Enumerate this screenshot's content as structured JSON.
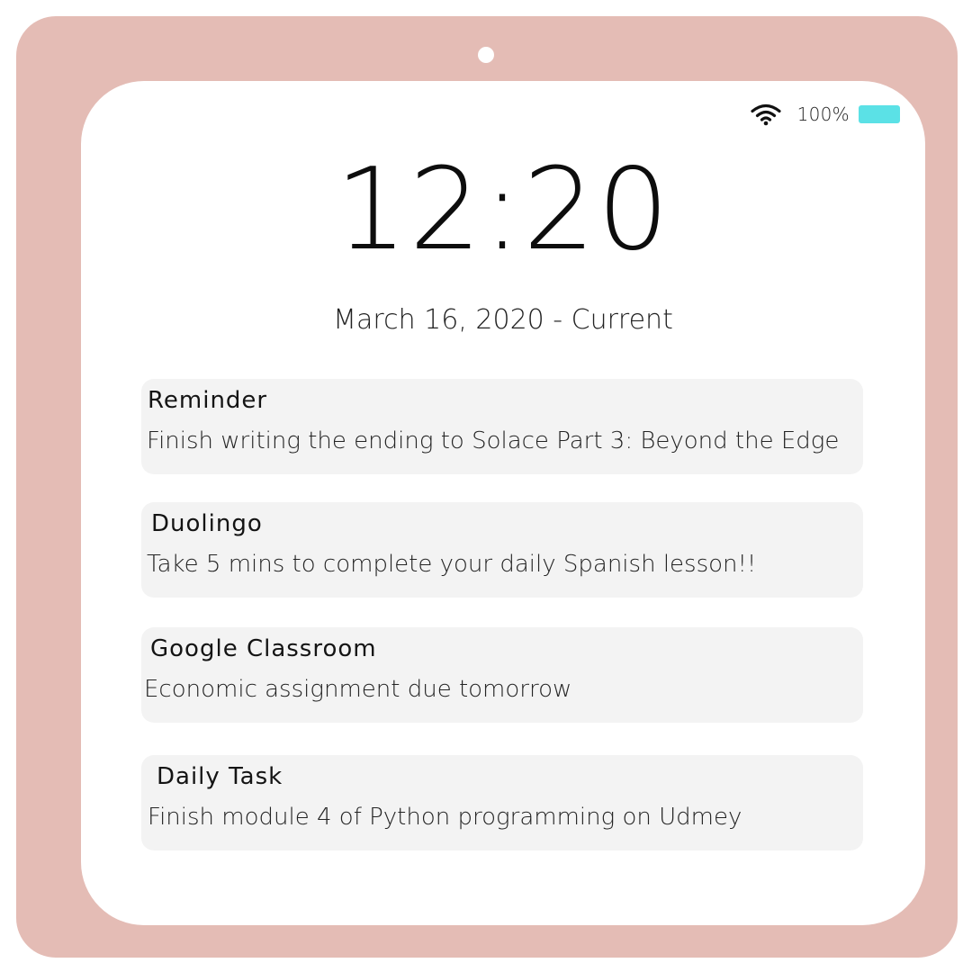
{
  "status_bar": {
    "wifi_icon": "wifi-icon",
    "battery_percent": "100%",
    "battery_color": "#5be1e6"
  },
  "lock_screen": {
    "time": "12:20",
    "date": "March 16, 2020 - Current"
  },
  "notifications": [
    {
      "title": "Reminder",
      "body": "Finish writing the ending to Solace Part 3: Beyond the Edge"
    },
    {
      "title": "Duolingo",
      "body": "Take 5 mins to complete your daily Spanish lesson!!"
    },
    {
      "title": "Google Classroom",
      "body": "Economic assignment due tomorrow"
    },
    {
      "title": "Daily Task",
      "body": "Finish module 4 of Python programming on Udmey"
    }
  ],
  "colors": {
    "device_frame": "#e4bcb5",
    "screen": "#ffffff",
    "notification_bg": "#f3f3f3"
  }
}
